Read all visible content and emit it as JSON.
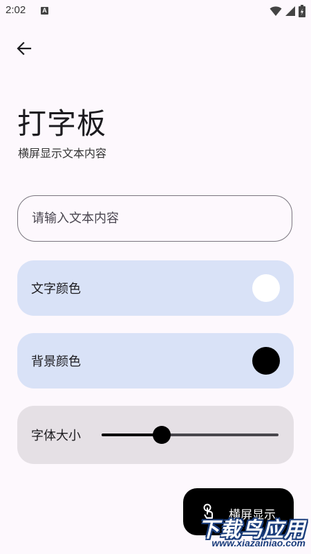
{
  "status_bar": {
    "time": "2:02",
    "a_badge": "A",
    "icons": [
      "wifi-icon",
      "signal-icon",
      "battery-icon"
    ]
  },
  "header": {
    "back_icon": "arrow-left-icon",
    "title": "打字板",
    "subtitle": "横屏显示文本内容"
  },
  "text_input": {
    "value": "",
    "placeholder": "请输入文本内容"
  },
  "text_color_card": {
    "label": "文字颜色",
    "color": "#ffffff"
  },
  "bg_color_card": {
    "label": "背景颜色",
    "color": "#000000"
  },
  "font_size_card": {
    "label": "字体大小",
    "slider_fraction": 0.34
  },
  "fab": {
    "label": "横屏显示",
    "icon": "touch-icon"
  },
  "watermark": {
    "main": "下载鸟应用",
    "url": "www.xiazainiao.com"
  },
  "colors": {
    "background": "#fdf8fd",
    "card_blue": "#d9e2f7",
    "card_grey": "#e5e0e5",
    "fab": "#000000"
  }
}
